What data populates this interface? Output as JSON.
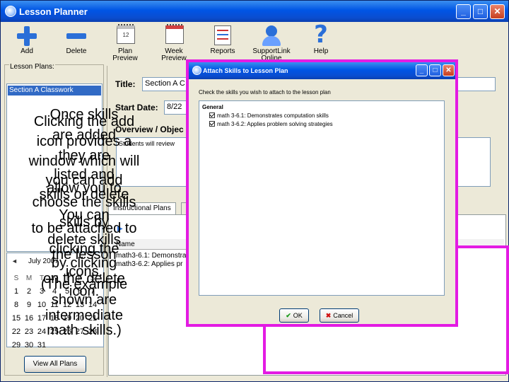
{
  "window": {
    "title": "Lesson Planner",
    "controls": {
      "minimize": "_",
      "maximize": "□",
      "close": "✕"
    }
  },
  "toolbar": [
    {
      "label": "Add",
      "icon": "add-plus-icon"
    },
    {
      "label": "Delete",
      "icon": "delete-minus-icon"
    },
    {
      "label_line1": "Plan",
      "label_line2": "Preview",
      "icon": "calendar-day-icon",
      "badge": "12"
    },
    {
      "label_line1": "Week",
      "label_line2": "Preview",
      "icon": "calendar-week-icon"
    },
    {
      "label": "Reports",
      "icon": "report-icon"
    },
    {
      "label_line1": "SupportLink",
      "label_line2": "Online",
      "icon": "support-person-icon"
    },
    {
      "label": "Help",
      "icon": "help-question-icon",
      "glyph": "?"
    }
  ],
  "left_panel": {
    "group_label": "Lesson Plans:",
    "plans": [
      "Section A Classwork"
    ],
    "calendar": {
      "nav": "◄",
      "month": "July 2007",
      "dow": [
        "S",
        "M",
        "T",
        "W",
        "T",
        "F",
        "S"
      ],
      "weeks": [
        [
          "1",
          "2",
          "3",
          "4",
          "5",
          "6",
          "7"
        ],
        [
          "8",
          "9",
          "10",
          "11",
          "12",
          "13",
          "14"
        ],
        [
          "15",
          "16",
          "17",
          "18",
          "19",
          "20",
          "21"
        ],
        [
          "22",
          "23",
          "24",
          "25",
          "26",
          "27",
          "28"
        ],
        [
          "29",
          "30",
          "31",
          "",
          "",
          "",
          ""
        ]
      ]
    },
    "view_all_button": "View All Plans"
  },
  "form": {
    "title_label": "Title:",
    "title_value": "Section A C",
    "start_date_label": "Start Date:",
    "start_date_value": "8/22",
    "overview_label": "Overview / Objec",
    "overview_text": "Students will review",
    "tabs": [
      "Instructional Plans",
      "S"
    ],
    "list_header": "Name",
    "list_rows": [
      "math3-6.1: Demonstrat",
      "math3-6.2: Applies pr"
    ]
  },
  "callout": {
    "lines": [
      "Once skills",
      "Clicking the add",
      "are added",
      "icon provides a",
      "they are",
      "window which will",
      "listed and",
      "you can add",
      "allow you to",
      "skills or delete",
      "choose the skills",
      "You can",
      "skills by",
      "to be attached to",
      "delete skills",
      "clicking the",
      "the lesson",
      "by clicking",
      "icons.",
      "on the delete",
      "(The example",
      "icon.",
      "shown are",
      "intermediate",
      "math skills.)"
    ]
  },
  "dialog": {
    "title": "Attach Skills to Lesson Plan",
    "instruction": "Check the skills you wish to attach to the lesson plan",
    "group": "General",
    "skills": [
      {
        "label": "math 3-6.1: Demonstrates computation skills",
        "checked": true
      },
      {
        "label": "math 3-6.2: Applies problem solving strategies",
        "checked": true
      }
    ],
    "ok_label": "OK",
    "cancel_label": "Cancel"
  },
  "colors": {
    "highlight_outline": "#e31be3",
    "titlebar_blue": "#0055e5",
    "selection_blue": "#316ac5"
  }
}
